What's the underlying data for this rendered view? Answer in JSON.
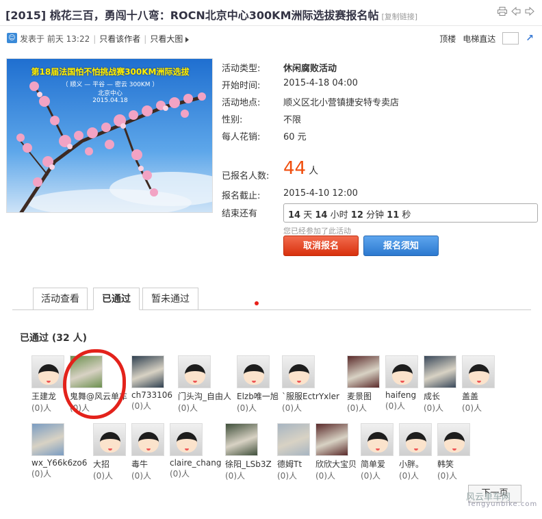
{
  "header": {
    "title": "[2015] 桃花三百，勇闯十八弯：ROCN北京中心300KM洲际选拔赛报名帖",
    "copy_link": "[复制链接]"
  },
  "info_bar": {
    "posted": "发表于 前天 13:22",
    "only_author": "只看该作者",
    "only_big_image": "只看大图",
    "top_floor": "顶楼",
    "elevator": "电梯直达"
  },
  "poster": {
    "title": "第18届法国怕不怕挑战赛300KM洲际选拔",
    "route": "（ 顺义 — 平谷 — 密云 300KM ）",
    "org": "北京中心",
    "date": "2015.04.18"
  },
  "details": {
    "type_label": "活动类型:",
    "type_value": "休闲腐败活动",
    "start_label": "开始时间:",
    "start_value": "2015-4-18 04:00",
    "place_label": "活动地点:",
    "place_value": "顺义区北小营镇捷安特专卖店",
    "gender_label": "性别:",
    "gender_value": "不限",
    "cost_label": "每人花销:",
    "cost_value": "60 元",
    "count_label": "已报名人数:",
    "count_value": "44",
    "count_unit": "人",
    "deadline_label": "报名截止:",
    "deadline_value": "2015-4-10 12:00",
    "remain_label": "结束还有",
    "days": "14",
    "days_unit": "天",
    "hours": "14",
    "hours_unit": "小时",
    "minutes": "12",
    "minutes_unit": "分钟",
    "seconds": "11",
    "seconds_unit": "秒",
    "joined_note": "您已经参加了此活动",
    "cancel_button": "取消报名",
    "notice_button": "报名须知"
  },
  "tabs": [
    {
      "label": "活动查看"
    },
    {
      "label": "已通过"
    },
    {
      "label": "暂未通过"
    }
  ],
  "list_title": "已通过 (32 人)",
  "members": [
    {
      "name": "王建龙",
      "count": "(0)人",
      "avatar": "default"
    },
    {
      "name": "鬼舞@风云单车",
      "count": "(0)人",
      "avatar": "photo"
    },
    {
      "name": "ch733106",
      "count": "(0)人",
      "avatar": "photo"
    },
    {
      "name": "门头沟_自由人",
      "count": "(0)人",
      "avatar": "default"
    },
    {
      "name": "Elzb唯一旭",
      "count": "(0)人",
      "avatar": "default"
    },
    {
      "name": "`服服EctrYxler",
      "count": "(0)人",
      "avatar": "default"
    },
    {
      "name": "麦景图",
      "count": "(0)人",
      "avatar": "photo"
    },
    {
      "name": "haifeng",
      "count": "(0)人",
      "avatar": "default"
    },
    {
      "name": "成长",
      "count": "(0)人",
      "avatar": "photo"
    },
    {
      "name": "盖盖",
      "count": "(0)人",
      "avatar": "default"
    },
    {
      "name": "wx_Y66k6zo6",
      "count": "(0)人",
      "avatar": "photo"
    },
    {
      "name": "大招",
      "count": "(0)人",
      "avatar": "default"
    },
    {
      "name": "毒牛",
      "count": "(0)人",
      "avatar": "default"
    },
    {
      "name": "claire_chang",
      "count": "(0)人",
      "avatar": "default"
    },
    {
      "name": "徐阳_LSb3Z",
      "count": "(0)人",
      "avatar": "photo"
    },
    {
      "name": "德姆Tt",
      "count": "(0)人",
      "avatar": "photo"
    },
    {
      "name": "欣欣大宝贝",
      "count": "(0)人",
      "avatar": "photo"
    },
    {
      "name": "简单爱",
      "count": "(0)人",
      "avatar": "default"
    },
    {
      "name": "小胖。",
      "count": "(0)人",
      "avatar": "default"
    },
    {
      "name": "韩笑",
      "count": "(0)人",
      "avatar": "default"
    }
  ],
  "pagination": {
    "next": "下一页"
  },
  "watermark": {
    "text": "风云单车网",
    "url": "fengyunbike.com"
  },
  "colors": {
    "count": "#f04e0d",
    "cancel": "#d8310d",
    "notice": "#2c79cf",
    "annotation": "#e3221b"
  }
}
